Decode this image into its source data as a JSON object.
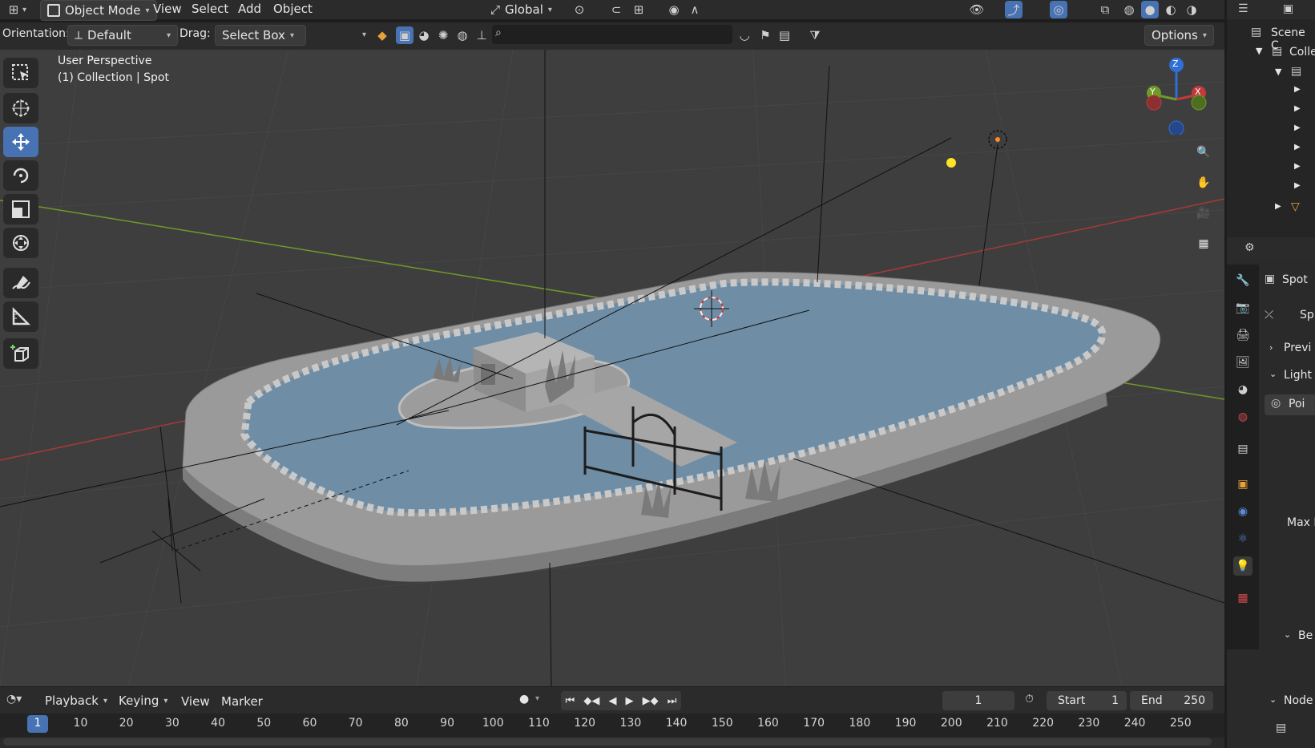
{
  "header": {
    "mode": "Object Mode",
    "menus": [
      "View",
      "Select",
      "Add",
      "Object"
    ],
    "transform_orientation": "Global",
    "orientation_label": "Orientation:",
    "orientation_value": "Default",
    "drag_label": "Drag:",
    "drag_value": "Select Box",
    "options_label": "Options"
  },
  "viewport": {
    "perspective": "User Perspective",
    "collection_info": "(1) Collection | Spot",
    "gizmo": {
      "z": "Z",
      "y": "Y",
      "x": "X"
    },
    "colors": {
      "background": "#3e3e3e",
      "x_axis": "#c23a3a",
      "y_axis": "#6f9a28",
      "z_axis": "#2f6fd6",
      "light": "#ffe22a"
    }
  },
  "toolbar": {
    "tools": [
      "select-box",
      "cursor",
      "move",
      "rotate",
      "scale",
      "transform",
      "annotate",
      "measure",
      "add-cube"
    ],
    "active_tool": "move"
  },
  "outliner": {
    "title": "Scene C",
    "collection": "Colle"
  },
  "properties": {
    "object_name": "Spot",
    "data_name": "Sp",
    "preview_label": "Previ",
    "light_label": "Light",
    "light_type": "Poi",
    "max_label": "Max I",
    "beam_label": "Be",
    "nodes_label": "Node"
  },
  "timeline": {
    "menus": [
      "Playback",
      "Keying",
      "View",
      "Marker"
    ],
    "current_frame": "1",
    "start_label": "Start",
    "start_value": "1",
    "end_label": "End",
    "end_value": "250",
    "ticks": [
      "1",
      "10",
      "20",
      "30",
      "40",
      "50",
      "60",
      "70",
      "80",
      "90",
      "100",
      "110",
      "120",
      "130",
      "140",
      "150",
      "160",
      "170",
      "180",
      "190",
      "200",
      "210",
      "220",
      "230",
      "240",
      "250"
    ]
  }
}
